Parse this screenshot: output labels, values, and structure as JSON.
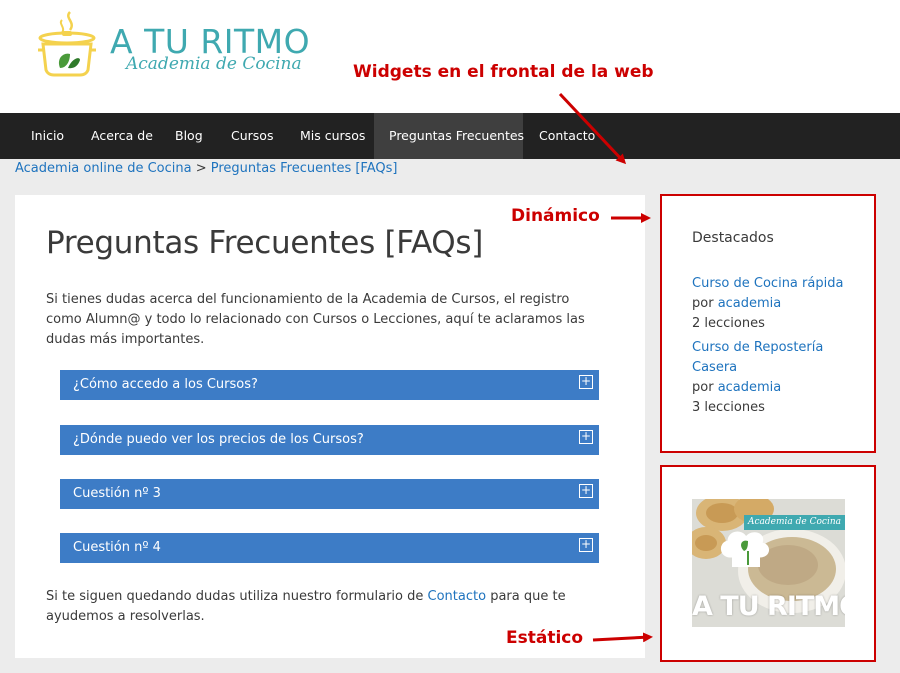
{
  "colors": {
    "accent": "#3d7cc6",
    "brand": "#3fa9b0",
    "nav_bg": "#222222",
    "link": "#1e73be",
    "annotation": "#cc0000"
  },
  "logo": {
    "title": "A TU RITMO",
    "subtitle": "Academia de Cocina",
    "icon": "cooking-pot-icon"
  },
  "nav": {
    "items": [
      {
        "label": "Inicio"
      },
      {
        "label": "Acerca de"
      },
      {
        "label": "Blog"
      },
      {
        "label": "Cursos"
      },
      {
        "label": "Mis cursos"
      },
      {
        "label": "Preguntas Frecuentes",
        "active": true
      },
      {
        "label": "Contacto"
      }
    ]
  },
  "breadcrumb": {
    "home": "Academia online de Cocina",
    "separator": ">",
    "current": "Preguntas Frecuentes [FAQs]"
  },
  "page": {
    "title": "Preguntas Frecuentes [FAQs]",
    "intro": "Si tienes dudas acerca del funcionamiento de la Academia de Cursos, el registro como Alumn@ y todo lo relacionado con Cursos o Lecciones, aquí te aclaramos las dudas más importantes.",
    "faqs": [
      {
        "question": "¿Cómo accedo a los Cursos?",
        "toggle": "+"
      },
      {
        "question": "¿Dónde puedo ver los precios de los Cursos?",
        "toggle": "+"
      },
      {
        "question": "Cuestión nº 3",
        "toggle": "+"
      },
      {
        "question": "Cuestión nº 4",
        "toggle": "+"
      }
    ],
    "outro_before": "Si te siguen quedando dudas utiliza nuestro formulario de ",
    "outro_link": "Contacto",
    "outro_after": " para que te ayudemos a resolverlas."
  },
  "sidebar": {
    "widget_title": "Destacados",
    "courses": [
      {
        "name_line1": "Curso de Cocina rápida",
        "name_line2": "",
        "by": "por ",
        "author": "academia",
        "lessons": "2 lecciones"
      },
      {
        "name_line1": "Curso de Repostería",
        "name_line2": "Casera",
        "by": "por ",
        "author": "academia",
        "lessons": "3 lecciones"
      }
    ],
    "promo": {
      "label": "Academia de Cocina",
      "brand": "A TU RITMO"
    }
  },
  "annotations": {
    "widgets": "Widgets en el frontal de la web",
    "dynamic": "Dinámico",
    "static": "Estático"
  }
}
